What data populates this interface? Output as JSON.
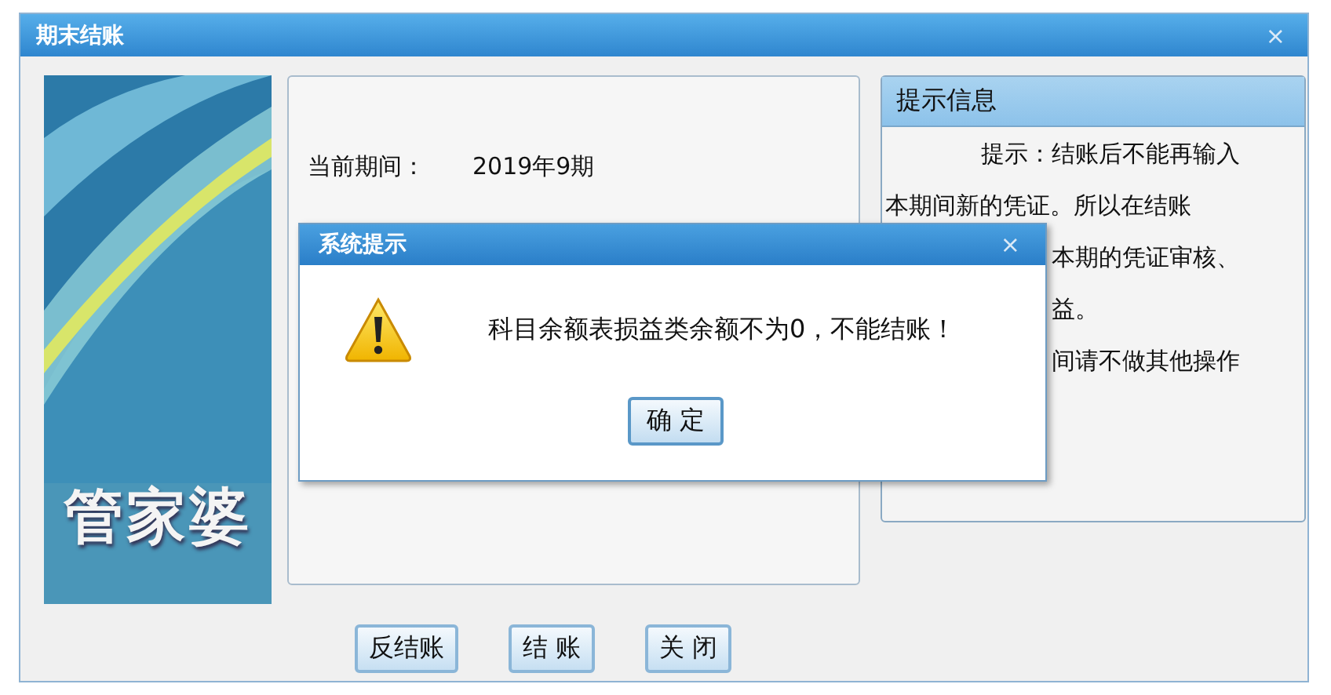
{
  "window": {
    "title": "期末结账",
    "close": "×"
  },
  "logo": {
    "text": "管家婆"
  },
  "period": {
    "label": "当前期间：",
    "value": "2019年9期"
  },
  "hint_panel": {
    "title": "提示信息",
    "lines": [
      {
        "kind": "indent",
        "text": "提示：结账后不能再输入"
      },
      {
        "kind": "full",
        "text": "本期间新的凭证。所以在结账"
      },
      {
        "kind": "cut",
        "text": "本期的凭证审核、"
      },
      {
        "kind": "cut",
        "text": "益。"
      },
      {
        "kind": "cut",
        "text": "间请不做其他操作"
      }
    ]
  },
  "buttons": [
    "反结账",
    "结 账",
    "关 闭"
  ],
  "dialog": {
    "title": "系统提示",
    "close": "×",
    "message": "科目余额表损益类余额不为0，不能结账！",
    "button": "确 定"
  }
}
